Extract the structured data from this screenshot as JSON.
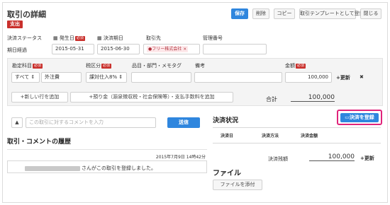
{
  "header": {
    "title": "取引の詳細",
    "type_badge": "支出",
    "buttons": {
      "save": "保存",
      "delete": "削除",
      "copy": "コピー",
      "template": "取引テンプレートとして登録",
      "close": "閉じる"
    }
  },
  "fields": {
    "status_label": "決済ステータス",
    "status_value": "期日経過",
    "issue_date_label": "発生日",
    "issue_date_value": "2015-05-31",
    "due_date_label": "決済期日",
    "due_date_value": "2015-06-30",
    "partner_label": "取引先",
    "partner_value": "フリー株式会社",
    "ref_label": "管理番号",
    "ref_value": "",
    "required_mark": "必須"
  },
  "detail": {
    "headers": {
      "account": "勘定科目",
      "tax": "税区分",
      "item": "品目・部門・メモタグ",
      "note": "備考",
      "amount": "金額"
    },
    "row": {
      "account_filter": "すべて",
      "account_value": "外注費",
      "tax_value": "課対仕入8%",
      "item_value": "",
      "note_value": "",
      "amount_value": "100,000",
      "update_label": "更新",
      "delete_mark": "✖"
    },
    "add_row_button": "新しい行を追加",
    "add_deposit_button": "預り金（源泉徴収税・社会保険等）・支払手数料を追加",
    "total_label": "合計",
    "total_value": "100,000"
  },
  "comment": {
    "placeholder": "この取引に対するコメントを入力",
    "send_button": "送信",
    "history_title": "取引・コメントの履歴",
    "history_timestamp": "2015年7月9日 14時42分",
    "history_text": "さんがこの取引を登録しました。"
  },
  "payment": {
    "title": "決済状況",
    "register_button": "決済を登録",
    "columns": [
      "決済日",
      "決済方法",
      "決済金額"
    ],
    "remaining_label": "決済残額",
    "remaining_value": "100,000",
    "update_label": "更新"
  },
  "file": {
    "title": "ファイル",
    "attach_button": "ファイルを添付"
  },
  "colors": {
    "accent_blue": "#2f86de",
    "badge_red": "#c9302c",
    "highlight_pink": "#e0247b"
  }
}
